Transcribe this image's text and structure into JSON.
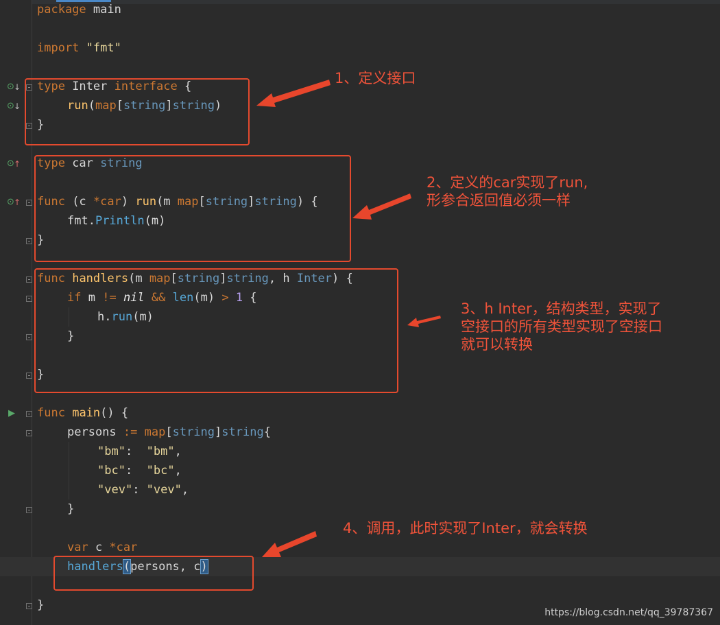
{
  "editor": {
    "lines": {
      "l1": {
        "kw": "package",
        "rest": " main"
      },
      "l3": {
        "kw": "import",
        "str": "\"fmt\""
      },
      "l5": {
        "kw": "type",
        "name": " Inter ",
        "kw2": "interface",
        "rest": " {"
      },
      "l6": {
        "fn": "run",
        "p1": "(",
        "kw": "map",
        "p2": "[",
        "t1": "string",
        "p3": "]",
        "t2": "string",
        "p4": ")"
      },
      "l7": {
        "rest": "}"
      },
      "l9": {
        "kw": "type",
        "name": " car ",
        "t": "string"
      },
      "l11": {
        "kw": "func",
        "p1": " (c ",
        "kw2": "*car",
        "p2": ") ",
        "fn": "run",
        "p3": "(m ",
        "kw3": "map",
        "p4": "[",
        "t1": "string",
        "p5": "]",
        "t2": "string",
        "p6": ") {"
      },
      "l12": {
        "pkg": "fmt.",
        "call": "Println",
        "rest": "(m)"
      },
      "l13": {
        "rest": "}"
      },
      "l15": {
        "kw": "func",
        "sp": " ",
        "fn": "handlers",
        "p1": "(m ",
        "kw2": "map",
        "p2": "[",
        "t1": "string",
        "p3": "]",
        "t2": "string",
        "p4": ", h ",
        "t3": "Inter",
        "p5": ") {"
      },
      "l16": {
        "kw": "if",
        "p1": " m ",
        "op1": "!=",
        "sp1": " ",
        "nil": "nil",
        "sp2": " ",
        "op2": "&&",
        "sp3": " ",
        "call": "len",
        "p2": "(m) ",
        "op3": ">",
        "sp4": " ",
        "num": "1",
        "p3": " {"
      },
      "l17": {
        "pkg": "h.",
        "call": "run",
        "rest": "(m)"
      },
      "l18": {
        "rest": "}"
      },
      "l20": {
        "rest": "}"
      },
      "l22": {
        "kw": "func",
        "sp": " ",
        "fn": "main",
        "rest": "() {"
      },
      "l23": {
        "p1": "persons ",
        "op": ":=",
        "sp": " ",
        "kw": "map",
        "p2": "[",
        "t1": "string",
        "p3": "]",
        "t2": "string",
        "p4": "{"
      },
      "l24": {
        "k": "\"bm\"",
        "c": ":  ",
        "v": "\"bm\"",
        "e": ","
      },
      "l25": {
        "k": "\"bc\"",
        "c": ":  ",
        "v": "\"bc\"",
        "e": ","
      },
      "l26": {
        "k": "\"vev\"",
        "c": ": ",
        "v": "\"vev\"",
        "e": ","
      },
      "l27": {
        "rest": "}"
      },
      "l29": {
        "kw": "var",
        "p1": " c ",
        "kw2": "*car"
      },
      "l30": {
        "call": "handlers",
        "po": "(",
        "p1": "persons, c",
        "pc": ")"
      },
      "l32": {
        "rest": "}"
      }
    }
  },
  "annotations": {
    "a1": "1、定义接口",
    "a2_line1": "2、定义的car实现了run,",
    "a2_line2": "形参合返回值必须一样",
    "a3_line1": "3、h Inter，结构类型，实现了",
    "a3_line2": "空接口的所有类型实现了空接口",
    "a3_line3": "就可以转换",
    "a4": "4、调用，此时实现了Inter，就会转换"
  },
  "watermark": "https://blog.csdn.net/qq_39787367",
  "colors": {
    "background": "#2b2b2b",
    "annotation": "#f0533a",
    "keyword": "#cc7832",
    "type": "#6897bb",
    "string": "#e8d79c",
    "function": "#ffc66d"
  }
}
